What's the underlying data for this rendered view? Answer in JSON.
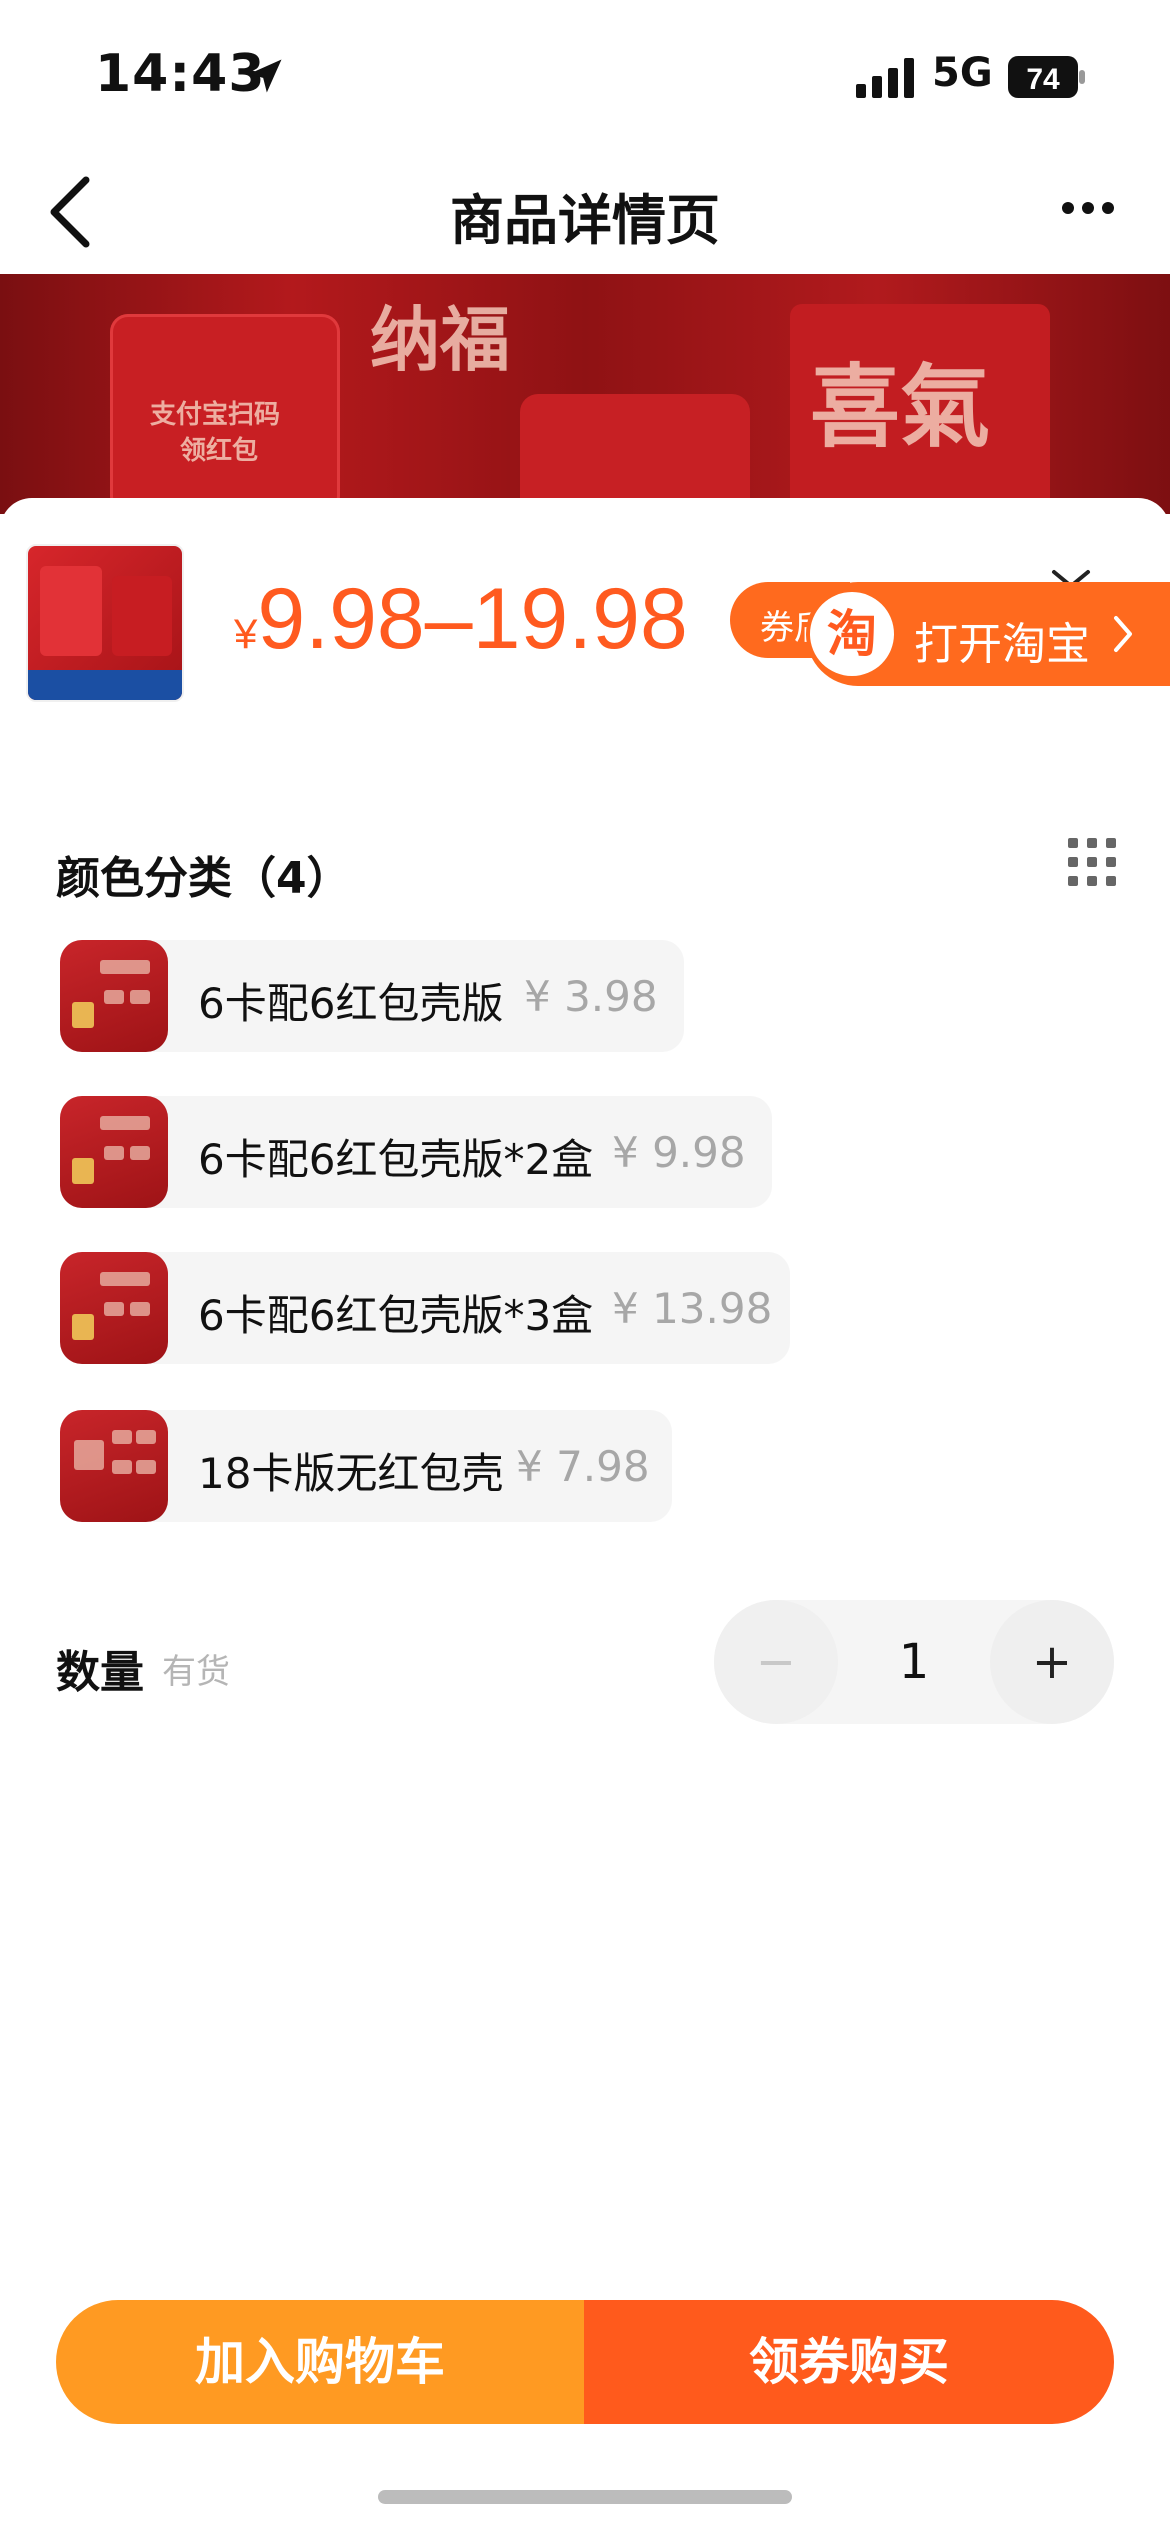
{
  "status_bar": {
    "time": "14:43",
    "network": "5G",
    "battery": "74"
  },
  "header": {
    "title": "商品详情页"
  },
  "banner": {
    "deco_texts": [
      "纳福",
      "喜氣",
      "支付宝扫码",
      "领红包"
    ]
  },
  "product": {
    "price_symbol": "¥",
    "price_range": "9.98–19.98",
    "coupon_label": "券后",
    "open_app_label": "打开淘宝",
    "taobao_logo_char": "淘"
  },
  "variants": {
    "section_title": "颜色分类（4）",
    "options": [
      {
        "label": "6卡配6红包壳版",
        "price": "¥ 3.98"
      },
      {
        "label": "6卡配6红包壳版*2盒",
        "price": "¥ 9.98"
      },
      {
        "label": "6卡配6红包壳版*3盒",
        "price": "¥ 13.98"
      },
      {
        "label": "18卡版无红包壳",
        "price": "¥ 7.98"
      }
    ]
  },
  "quantity": {
    "label": "数量",
    "stock": "有货",
    "value": "1",
    "minus": "−",
    "plus": "+"
  },
  "actions": {
    "add_to_cart": "加入购物车",
    "buy_with_coupon": "领券购买"
  },
  "colors": {
    "accent": "#ff5a1f",
    "cart": "#ff9a22",
    "buy": "#ff5a1c"
  }
}
